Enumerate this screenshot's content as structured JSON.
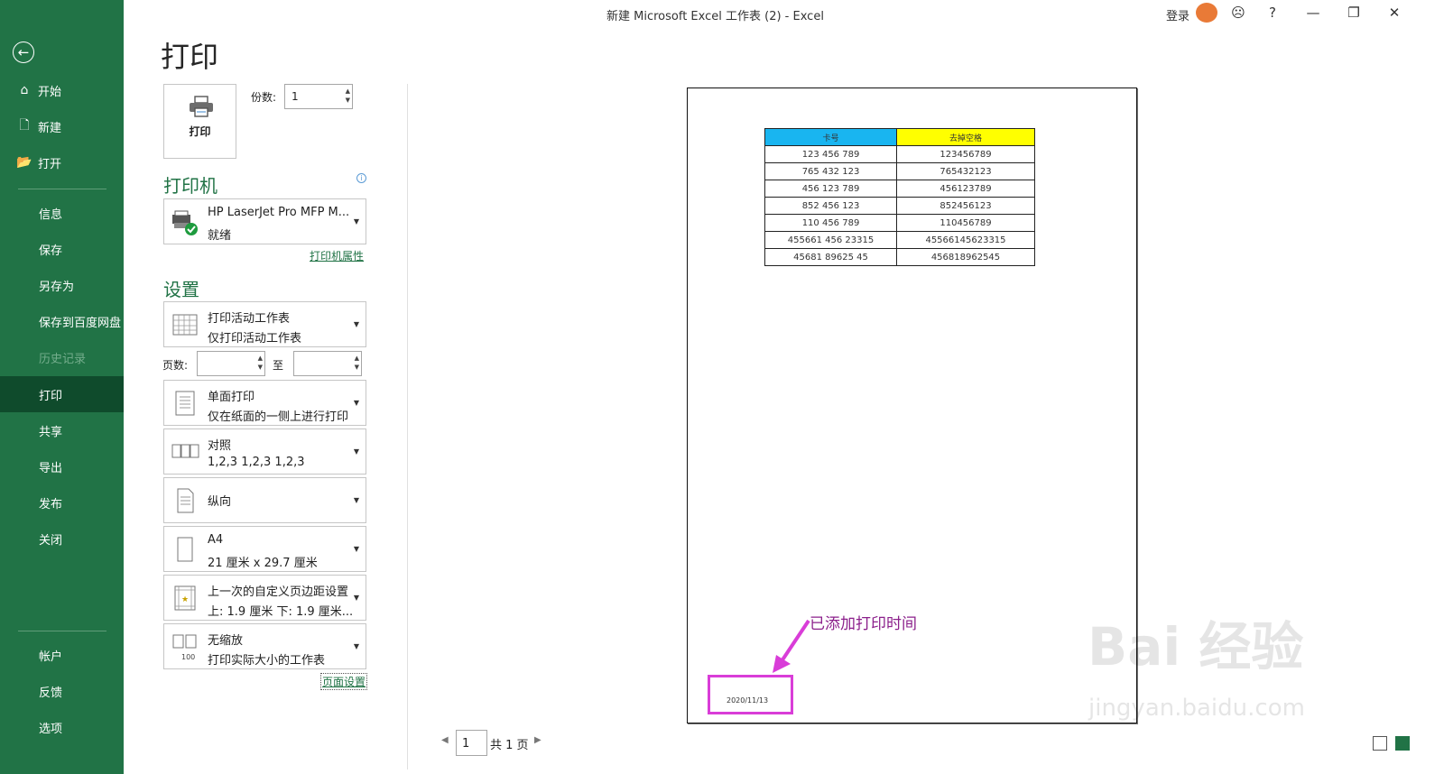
{
  "window": {
    "title": "新建 Microsoft Excel 工作表 (2)  -  Excel",
    "login": "登录",
    "help": "?",
    "minimize": "—",
    "restore": "❐",
    "close": "✕"
  },
  "sidebar": {
    "back": "←",
    "items": [
      {
        "label": "开始",
        "icon": "home-icon",
        "glyph": "⌂"
      },
      {
        "label": "新建",
        "icon": "new-doc-icon",
        "glyph": "🗋"
      },
      {
        "label": "打开",
        "icon": "open-folder-icon",
        "glyph": "📂"
      },
      {
        "label": "信息"
      },
      {
        "label": "保存"
      },
      {
        "label": "另存为"
      },
      {
        "label": "保存到百度网盘"
      },
      {
        "label": "历史记录"
      },
      {
        "label": "打印"
      },
      {
        "label": "共享"
      },
      {
        "label": "导出"
      },
      {
        "label": "发布"
      },
      {
        "label": "关闭"
      },
      {
        "label": "帐户"
      },
      {
        "label": "反馈"
      },
      {
        "label": "选项"
      }
    ]
  },
  "print": {
    "title": "打印",
    "button_label": "打印",
    "copies_label": "份数:",
    "copies_value": "1",
    "printer_heading": "打印机",
    "info": "i",
    "printer_name": "HP LaserJet Pro MFP M...",
    "printer_status": "就绪",
    "printer_properties": "打印机属性",
    "settings_heading": "设置",
    "settings": [
      {
        "line1": "打印活动工作表",
        "line2": "仅打印活动工作表"
      },
      {
        "line1": "单面打印",
        "line2": "仅在纸面的一侧上进行打印"
      },
      {
        "line1": "对照",
        "line2": "1,2,3    1,2,3    1,2,3"
      },
      {
        "line1": "纵向",
        "line2": ""
      },
      {
        "line1": "A4",
        "line2": "21 厘米 x 29.7 厘米"
      },
      {
        "line1": "上一次的自定义页边距设置",
        "line2": "上: 1.9 厘米 下: 1.9 厘米..."
      },
      {
        "line1": "无缩放",
        "line2": "打印实际大小的工作表"
      }
    ],
    "pages_label": "页数:",
    "to_label": "至",
    "page_setup": "页面设置"
  },
  "preview": {
    "headers": [
      "卡号",
      "去掉空格"
    ],
    "header_colors": [
      "#19b5f0",
      "#ffff00"
    ],
    "rows": [
      [
        "123    456    789",
        "123456789"
      ],
      [
        "765    432    123",
        "765432123"
      ],
      [
        "456    123    789",
        "456123789"
      ],
      [
        "852    456    123",
        "852456123"
      ],
      [
        "110    456    789",
        "110456789"
      ],
      [
        "455661    456    23315",
        "45566145623315"
      ],
      [
        "45681    89625    45",
        "456818962545"
      ]
    ],
    "footer_date": "2020/11/13",
    "annotation": "已添加打印时间",
    "page_current": "1",
    "page_total": "共 1 页"
  },
  "watermark": {
    "brand": "Bai 经验",
    "url": "jingyan.baidu.com"
  }
}
